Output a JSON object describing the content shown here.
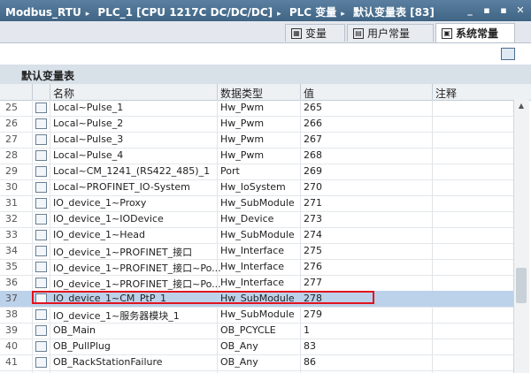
{
  "breadcrumb": [
    "Modbus_RTU",
    "PLC_1 [CPU 1217C DC/DC/DC]",
    "PLC 变量",
    "默认变量表 [83]"
  ],
  "window_controls": [
    "_",
    "▪",
    "▪",
    "✕"
  ],
  "tabs": [
    {
      "label": "变量",
      "active": false
    },
    {
      "label": "用户常量",
      "active": false
    },
    {
      "label": "系统常量",
      "active": true
    }
  ],
  "table_title": "默认变量表",
  "columns": {
    "name": "名称",
    "type": "数据类型",
    "value": "值",
    "comment": "注释"
  },
  "rows": [
    {
      "num": "25",
      "name": "Local~Pulse_1",
      "type": "Hw_Pwm",
      "value": "265"
    },
    {
      "num": "26",
      "name": "Local~Pulse_2",
      "type": "Hw_Pwm",
      "value": "266"
    },
    {
      "num": "27",
      "name": "Local~Pulse_3",
      "type": "Hw_Pwm",
      "value": "267"
    },
    {
      "num": "28",
      "name": "Local~Pulse_4",
      "type": "Hw_Pwm",
      "value": "268"
    },
    {
      "num": "29",
      "name": "Local~CM_1241_(RS422_485)_1",
      "type": "Port",
      "value": "269"
    },
    {
      "num": "30",
      "name": "Local~PROFINET_IO-System",
      "type": "Hw_IoSystem",
      "value": "270"
    },
    {
      "num": "31",
      "name": "IO_device_1~Proxy",
      "type": "Hw_SubModule",
      "value": "271"
    },
    {
      "num": "32",
      "name": "IO_device_1~IODevice",
      "type": "Hw_Device",
      "value": "273"
    },
    {
      "num": "33",
      "name": "IO_device_1~Head",
      "type": "Hw_SubModule",
      "value": "274"
    },
    {
      "num": "34",
      "name": "IO_device_1~PROFINET_接口",
      "type": "Hw_Interface",
      "value": "275"
    },
    {
      "num": "35",
      "name": "IO_device_1~PROFINET_接口~Po...",
      "type": "Hw_Interface",
      "value": "276"
    },
    {
      "num": "36",
      "name": "IO_device_1~PROFINET_接口~Po...",
      "type": "Hw_Interface",
      "value": "277"
    },
    {
      "num": "37",
      "name": "IO_device_1~CM_PtP_1",
      "type": "Hw_SubModule",
      "value": "278",
      "selected": true
    },
    {
      "num": "38",
      "name": "IO_device_1~服务器模块_1",
      "type": "Hw_SubModule",
      "value": "279"
    },
    {
      "num": "39",
      "name": "OB_Main",
      "type": "OB_PCYCLE",
      "value": "1"
    },
    {
      "num": "40",
      "name": "OB_PullPlug",
      "type": "OB_Any",
      "value": "83"
    },
    {
      "num": "41",
      "name": "OB_RackStationFailure",
      "type": "OB_Any",
      "value": "86"
    }
  ]
}
